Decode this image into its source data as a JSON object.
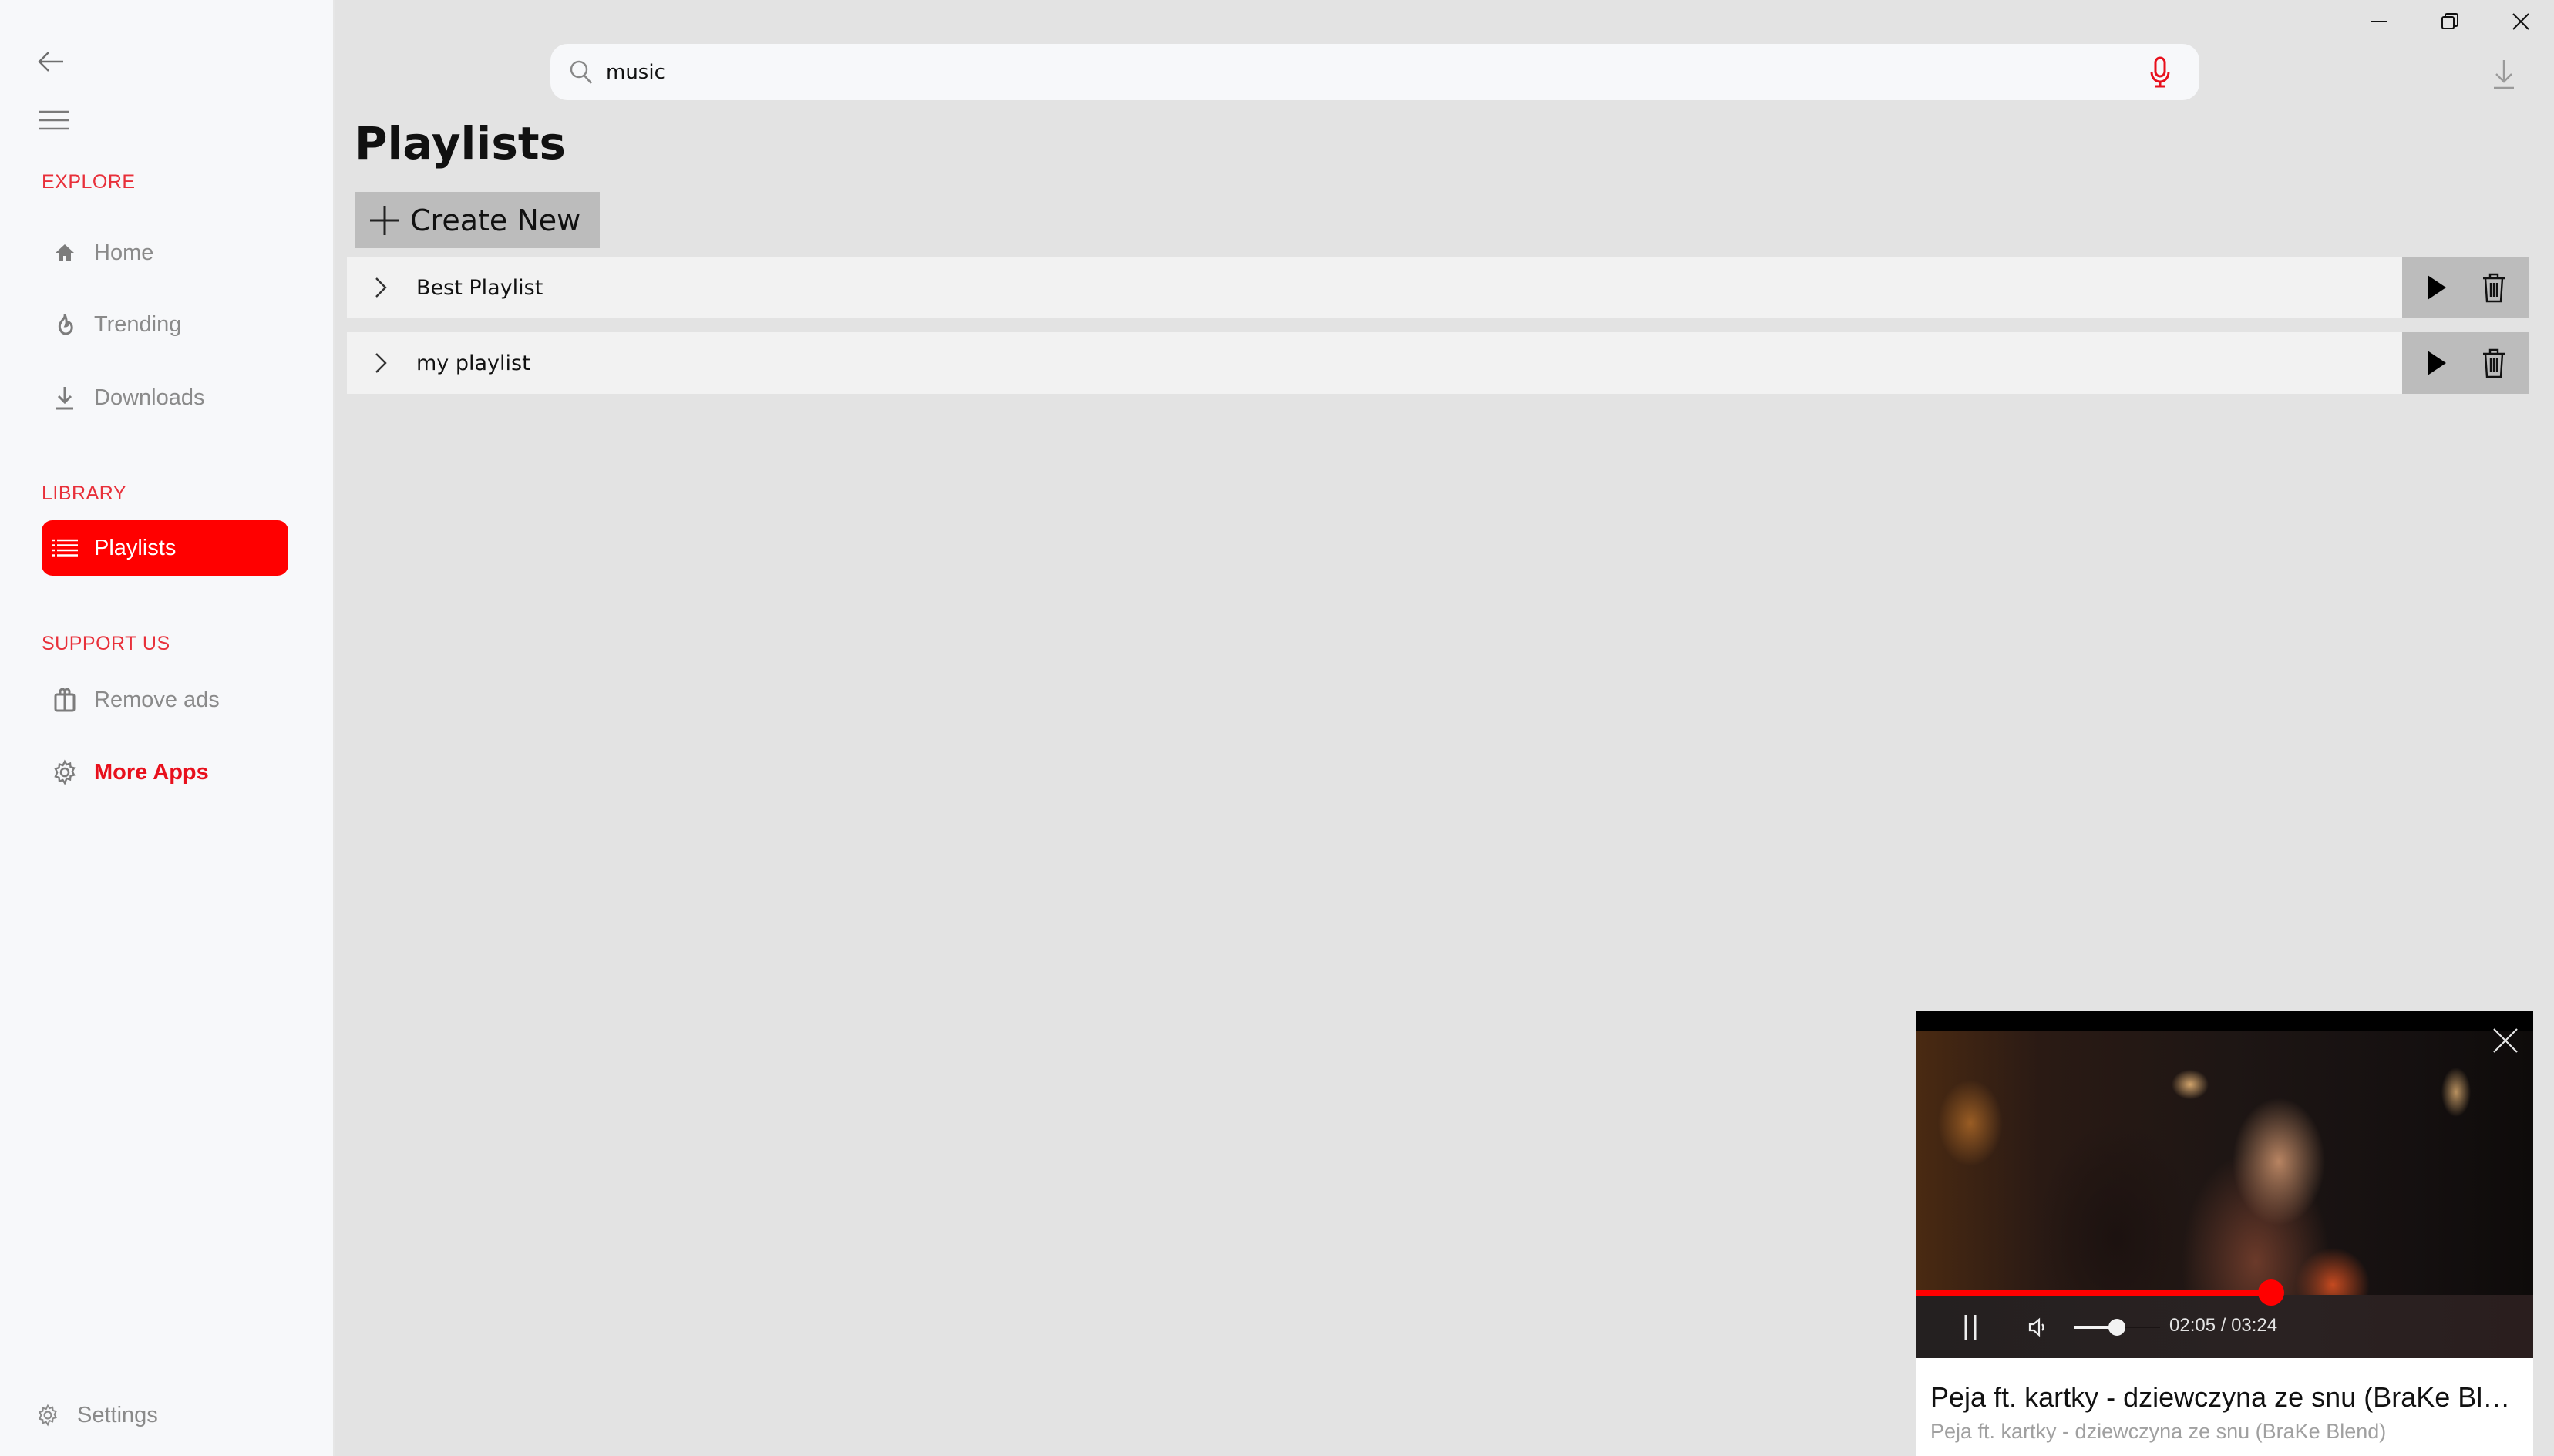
{
  "window": {
    "controls": {
      "minimize": "minimize-icon",
      "restore": "restore-icon",
      "close": "close-icon"
    }
  },
  "sidebar": {
    "back_icon": "arrow-left-icon",
    "menu_icon": "hamburger-icon",
    "sections": [
      {
        "label": "EXPLORE",
        "items": [
          {
            "label": "Home",
            "icon": "home-icon"
          },
          {
            "label": "Trending",
            "icon": "flame-icon"
          },
          {
            "label": "Downloads",
            "icon": "download-icon"
          }
        ]
      },
      {
        "label": "LIBRARY",
        "items": [
          {
            "label": "Playlists",
            "icon": "list-icon",
            "active": true
          }
        ]
      },
      {
        "label": "SUPPORT US",
        "items": [
          {
            "label": "Remove ads",
            "icon": "shopping-bag-icon"
          },
          {
            "label": "More Apps",
            "icon": "gear-icon",
            "accent": true
          }
        ]
      }
    ],
    "settings": {
      "label": "Settings",
      "icon": "gear-icon"
    }
  },
  "search": {
    "value": "music",
    "placeholder": "",
    "icon": "search-icon",
    "mic_icon": "microphone-icon"
  },
  "toolbar": {
    "download_icon": "download-icon"
  },
  "main": {
    "title": "Playlists",
    "create_new_label": "Create New",
    "playlists": [
      {
        "name": "Best Playlist"
      },
      {
        "name": "my playlist"
      }
    ]
  },
  "player": {
    "title": "Peja ft. kartky - dziewczyna ze snu (BraKe Blend)",
    "subtitle": "Peja ft. kartky - dziewczyna ze snu (BraKe Blend)",
    "current_time": "02:05",
    "duration": "03:24",
    "time_display": "02:05 / 03:24",
    "progress_fraction": 0.575,
    "volume_fraction": 0.5,
    "state": "playing"
  },
  "colors": {
    "accent": "#ff0000",
    "section_label": "#e8303a",
    "sidebar_bg": "#f7f8fa",
    "main_bg": "#e3e3e3",
    "row_bg": "#f2f2f2",
    "action_bg": "#bcbcbc"
  }
}
